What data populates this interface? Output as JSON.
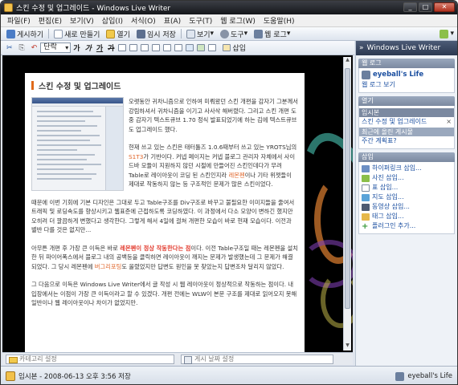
{
  "window": {
    "title": "스킨 수정 및 업그레이드 - Windows Live Writer",
    "controls": {
      "minimize": "_",
      "maximize": "□",
      "close": "✕"
    }
  },
  "menu": [
    "파일(F)",
    "편집(E)",
    "보기(V)",
    "삽입(I)",
    "서식(O)",
    "표(A)",
    "도구(T)",
    "웹 로그(W)",
    "도움말(H)"
  ],
  "toolbar": {
    "publish": "게시하기",
    "new": "새로 만들기",
    "open": "열기",
    "draft": "임시 저장",
    "view": "보기",
    "tools": "도구",
    "weblog": "웹 로그"
  },
  "format_toolbar": {
    "style_select": "단락",
    "bold": "가",
    "italic": "가",
    "underline": "가",
    "strike": "가",
    "insert_label": "삽입"
  },
  "post": {
    "title": "스킨 수정 및 업그레이드",
    "para1": [
      {
        "t": "오랫동안 귀차니즘으로 인하여 미뤄왔던 스킨 개편을 감자기 그분께서 강림하셔서 귀차니즘을 이기고 사사삭 해버렸다. 그리고 스킨 개편 도중 감자기 텍스트큐브 1.70 정식 발표되었기에 하는 김에 텍스트큐브도 업그레이드 했다."
      },
      {
        "t": ""
      }
    ],
    "para2": [
      {
        "t": "현재 쓰고 있는 스킨은 태터툴즈 1.0.6때부터 쓰고 있는 YROTS님의 "
      },
      {
        "t": "S1T3",
        "c": "orange"
      },
      {
        "t": "가 기반이다. 커넵 페이지는 커넵 블로그 관리자 자체에서 사이드바 모듈이 지원하지 않던 시절에 만들어진 스킨인데다가 무려 Table로 레이아웃이 코딩 된 스킨인지라 "
      },
      {
        "t": "레몬펜",
        "c": "orange"
      },
      {
        "t": "이나 기타 위젯들이 제대로 작동하지 않는 등 구조적인 문제가 많은 스킨이었다."
      }
    ],
    "para3": "때문에 이번 기회에 기본 디자인은 그대로 두고 Table구조를 Div구조로 바꾸고 불필요한 이미지들을 줄여서 트래픽 및 로딩속도를 향상시키고 웹표준에 근접하도록 코딩하였다. 이 과정에서 다소 모양이 변하긴 했지만 오히려 더 깔끔하게 변했다고 생각한다. 그렇게 해서 4일에 걸쳐 개편한 모습이 바로 현재 모습이다. 이전과 별반 다를 것은 없지만...",
    "para4": [
      {
        "t": "아무튼 개편 후 가장 큰 이득은 바로 "
      },
      {
        "t": "레몬펜이 정상 작동한다는 점",
        "c": "red"
      },
      {
        "t": "이다. 이전 Table구조일 때는 레몬펜을 설치한 뒤 파이어폭스에서 블로그 내의 공백등을 클릭하면 레이아웃이 깨지는 문제가 발생했는데 그 문제가 해결되었다. 그 당시 레몬펜에 "
      },
      {
        "t": "버그리포팅",
        "c": "orange"
      },
      {
        "t": "도 올렸었지만 답변도 원인을 못 찾았는지 답변조차 달리지 않았다."
      }
    ],
    "para5": "그 다음으로 이득은 Windows Live Writer에서 글 작성 시 웹 레이아웃이 정상적으로 작동하는 점이다. 내 입장에서는 이점이 가장 큰 이득이라고 할 수 있겠다. 개편 전에는 WLW이 본문 구조를 제대로 읽어오지 못해 일반이나 웹 레이아웃이나 차이가 없었지만."
  },
  "editor_bottom": {
    "category_placeholder": "카테고리 설정",
    "date_placeholder": "게시 날짜 설정"
  },
  "sidebar": {
    "header": "Windows Live Writer",
    "weblog_section": "웹 로그",
    "blog_name": "eyeball's Life",
    "view_weblog": "웹 로그 보기",
    "open_section": "열기",
    "draft_label": "임시본",
    "draft_item": "스킨 수정 및 업그레이드",
    "recent_label": "최근에 올린 게시물",
    "recent_item": "주간 계획표?",
    "insert_section": "삽입",
    "insert_items": [
      "하이퍼링크 삽입...",
      "사진 삽입...",
      "표 삽입...",
      "지도 삽입...",
      "동영상 삽입...",
      "태그 삽입..."
    ],
    "add_plugin": "플러그인 추가..."
  },
  "statusbar": {
    "text": "임시본 - 2008-06-13 오후 3:56 저장",
    "blog": "eyeball's Life"
  },
  "colors": {
    "title_accent": "#e06a1b",
    "link": "#1b4fa0",
    "highlight_red": "#e23b2e"
  }
}
